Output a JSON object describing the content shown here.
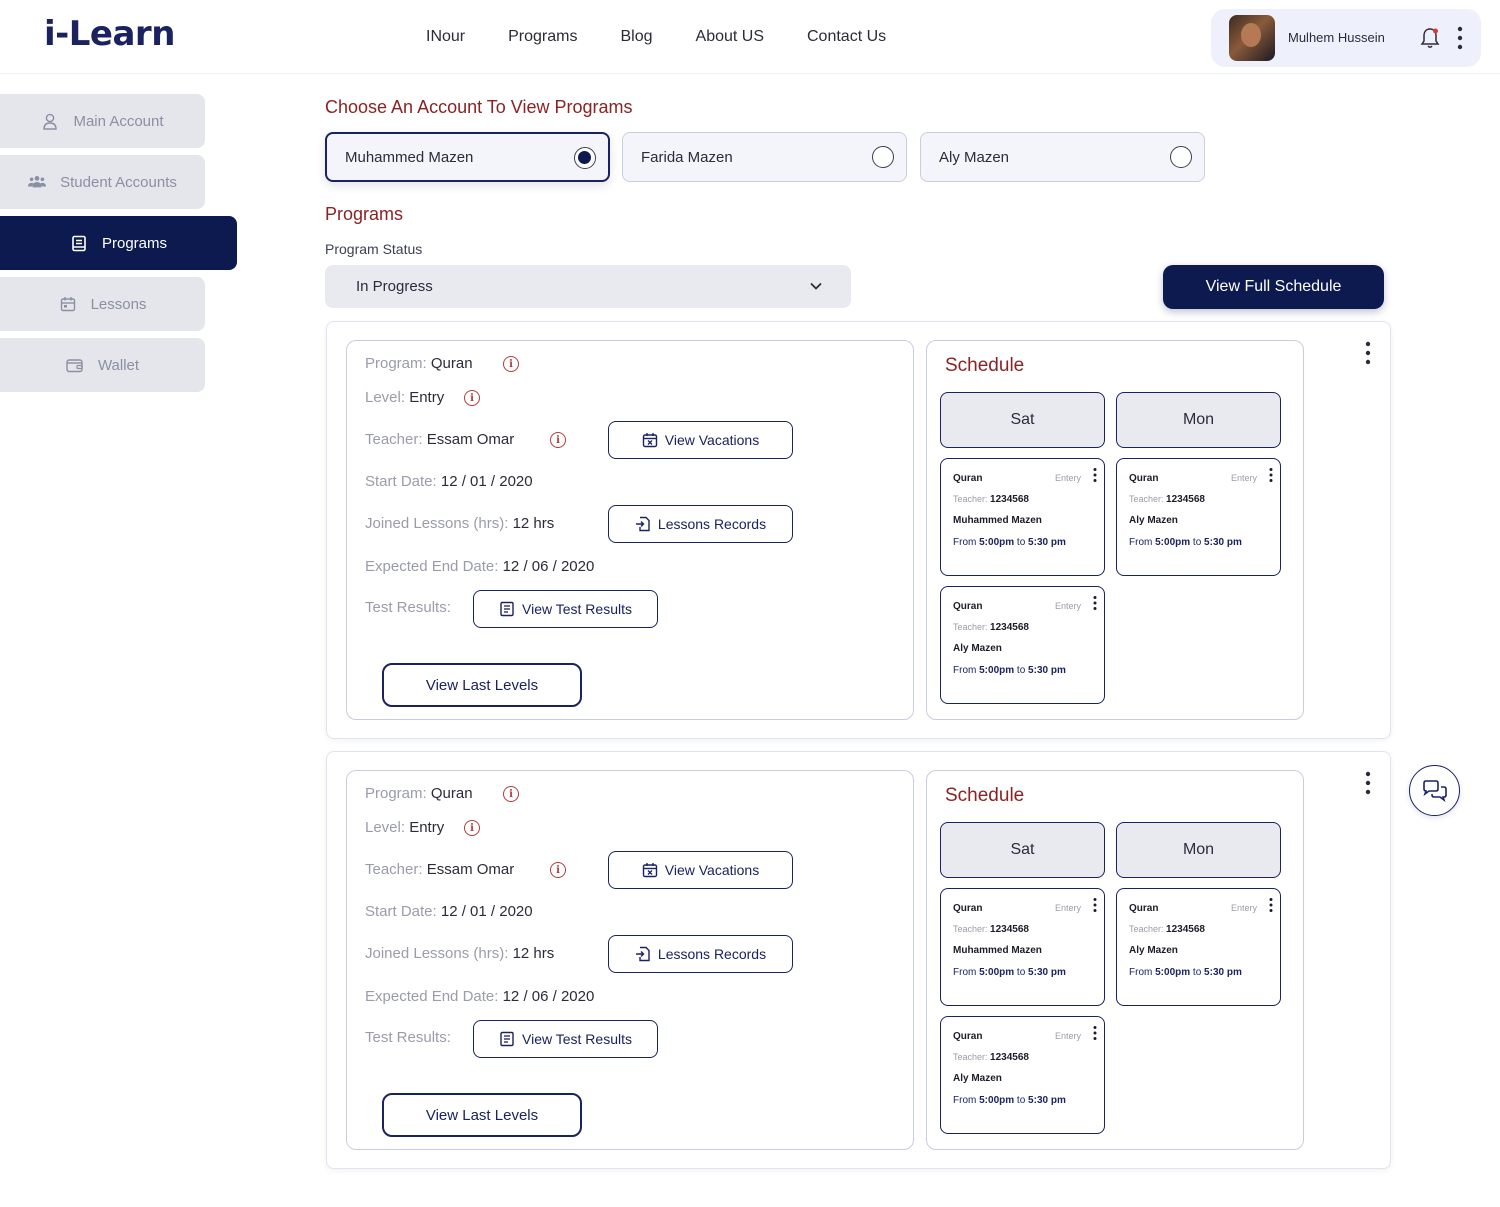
{
  "brand": {
    "logo": "i-Learn"
  },
  "nav": [
    "INour",
    "Programs",
    "Blog",
    "About US",
    "Contact Us"
  ],
  "user": {
    "name": "Mulhem Hussein"
  },
  "sidebar": {
    "items": [
      {
        "label": "Main Account",
        "icon": "user-icon"
      },
      {
        "label": "Student Accounts",
        "icon": "users-icon"
      },
      {
        "label": "Programs",
        "icon": "book-icon",
        "active": true
      },
      {
        "label": "Lessons",
        "icon": "calendar-icon"
      },
      {
        "label": "Wallet",
        "icon": "wallet-icon"
      }
    ]
  },
  "accounts": {
    "title": "Choose An Account To View Programs",
    "items": [
      {
        "name": "Muhammed Mazen",
        "selected": true
      },
      {
        "name": "Farida Mazen",
        "selected": false
      },
      {
        "name": "Aly Mazen",
        "selected": false
      }
    ]
  },
  "programs": {
    "title": "Programs",
    "status_label": "Program Status",
    "status_value": "In Progress",
    "full_schedule_btn": "View Full Schedule",
    "cards": [
      {
        "program_label": "Program:",
        "program": "Quran",
        "level_label": "Level:",
        "level": "Entry",
        "teacher_label": "Teacher:",
        "teacher": "Essam Omar",
        "start_label": "Start Date:",
        "start": "12 / 01 / 2020",
        "joined_label": "Joined Lessons (hrs):",
        "joined": "12 hrs",
        "end_label": "Expected End Date:",
        "end": "12 / 06 / 2020",
        "test_label": "Test Results:",
        "view_vacations": "View Vacations",
        "lessons_records": "Lessons Records",
        "view_test_results": "View Test Results",
        "view_last_levels": "View Last Levels",
        "schedule": {
          "title": "Schedule",
          "days": [
            "Sat",
            "Mon"
          ],
          "slots": [
            {
              "program": "Quran",
              "level": "Entery",
              "teacher_label": "Teacher:",
              "teacher": "1234568",
              "student": "Muhammed Mazen",
              "from_label": "From",
              "from": "5:00pm",
              "to_label": "to",
              "to": "5:30 pm"
            },
            {
              "program": "Quran",
              "level": "Entery",
              "teacher_label": "Teacher:",
              "teacher": "1234568",
              "student": "Aly Mazen",
              "from_label": "From",
              "from": "5:00pm",
              "to_label": "to",
              "to": "5:30 pm"
            },
            {
              "program": "Quran",
              "level": "Entery",
              "teacher_label": "Teacher:",
              "teacher": "1234568",
              "student": "Aly Mazen",
              "from_label": "From",
              "from": "5:00pm",
              "to_label": "to",
              "to": "5:30 pm"
            }
          ]
        }
      },
      {
        "program_label": "Program:",
        "program": "Quran",
        "level_label": "Level:",
        "level": "Entry",
        "teacher_label": "Teacher:",
        "teacher": "Essam Omar",
        "start_label": "Start Date:",
        "start": "12 / 01 / 2020",
        "joined_label": "Joined Lessons (hrs):",
        "joined": "12 hrs",
        "end_label": "Expected End Date:",
        "end": "12 / 06 / 2020",
        "test_label": "Test Results:",
        "view_vacations": "View Vacations",
        "lessons_records": "Lessons Records",
        "view_test_results": "View Test Results",
        "view_last_levels": "View Last Levels",
        "schedule": {
          "title": "Schedule",
          "days": [
            "Sat",
            "Mon"
          ],
          "slots": [
            {
              "program": "Quran",
              "level": "Entery",
              "teacher_label": "Teacher:",
              "teacher": "1234568",
              "student": "Muhammed Mazen",
              "from_label": "From",
              "from": "5:00pm",
              "to_label": "to",
              "to": "5:30 pm"
            },
            {
              "program": "Quran",
              "level": "Entery",
              "teacher_label": "Teacher:",
              "teacher": "1234568",
              "student": "Aly Mazen",
              "from_label": "From",
              "from": "5:00pm",
              "to_label": "to",
              "to": "5:30 pm"
            },
            {
              "program": "Quran",
              "level": "Entery",
              "teacher_label": "Teacher:",
              "teacher": "1234568",
              "student": "Aly Mazen",
              "from_label": "From",
              "from": "5:00pm",
              "to_label": "to",
              "to": "5:30 pm"
            }
          ]
        }
      }
    ]
  },
  "colors": {
    "brand": "#0d1a4f",
    "accent": "#8a2323",
    "surface": "#e8eaf0"
  }
}
